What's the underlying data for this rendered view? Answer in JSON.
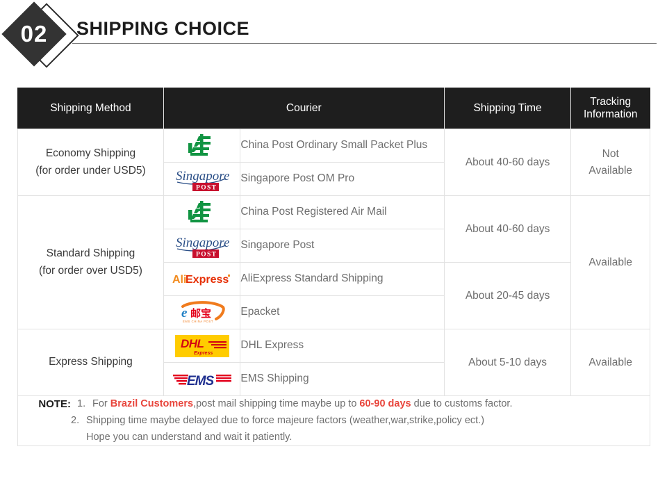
{
  "banner": {
    "number": "02",
    "title": "SHIPPING CHOICE"
  },
  "table": {
    "headers": {
      "method": "Shipping Method",
      "courier": "Courier",
      "time": "Shipping Time",
      "tracking_line1": "Tracking",
      "tracking_line2": "Information"
    },
    "rows": [
      {
        "method_line1": "Economy Shipping",
        "method_line2": "(for order under USD5)",
        "time": "About 40-60 days",
        "tracking_line1": "Not",
        "tracking_line2": "Available",
        "couriers": [
          {
            "logo": "china-post-logo",
            "name": "China Post Ordinary Small Packet Plus"
          },
          {
            "logo": "singapore-post-logo",
            "name": "Singapore Post OM Pro"
          }
        ]
      },
      {
        "method_line1": "Standard Shipping",
        "method_line2": "(for order over USD5)",
        "tracking": "Available",
        "time_groups": [
          {
            "time": "About 40-60 days"
          },
          {
            "time": "About 20-45 days"
          }
        ],
        "couriers": [
          {
            "logo": "china-post-logo",
            "name": "China Post Registered Air Mail"
          },
          {
            "logo": "singapore-post-logo",
            "name": "Singapore Post"
          },
          {
            "logo": "aliexpress-logo",
            "name": "AliExpress Standard Shipping"
          },
          {
            "logo": "epacket-logo",
            "name": "Epacket"
          }
        ]
      },
      {
        "method_line1": "Express Shipping",
        "method_line2": "",
        "time": "About 5-10 days",
        "tracking": "Available",
        "couriers": [
          {
            "logo": "dhl-logo",
            "name": "DHL Express"
          },
          {
            "logo": "ems-logo",
            "name": "EMS Shipping"
          }
        ]
      }
    ]
  },
  "note": {
    "label": "NOTE:",
    "item1_num": "1.",
    "item1_a": "For ",
    "item1_highlight1": "Brazil Customers",
    "item1_b": ",post mail shipping time maybe up to ",
    "item1_highlight2": "60-90 days",
    "item1_c": " due to customs factor.",
    "item2_num": "2.",
    "item2_line1": "Shipping time maybe delayed due to force majeure factors (weather,war,strike,policy ect.)",
    "item2_line2": "Hope you can understand and wait it patiently."
  },
  "colors": {
    "header_bg": "#1e1e1e",
    "accent_red": "#e8453c",
    "china_post_green": "#119442",
    "singpost_blue": "#2b4f87",
    "singpost_red": "#c8102e",
    "ali_orange": "#f28b1e",
    "ali_red": "#e62e04",
    "dhl_yellow": "#ffcc00",
    "dhl_red": "#d40511",
    "ems_blue": "#1f2f8f",
    "ems_red": "#e3001b",
    "epacket_orange": "#f07b1d",
    "epacket_blue": "#1f7fc4"
  }
}
